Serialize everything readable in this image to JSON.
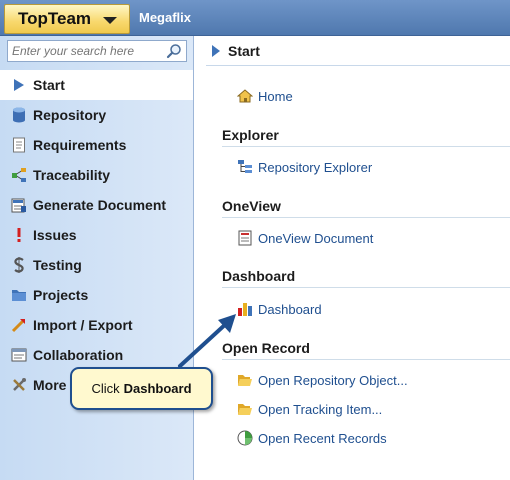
{
  "topbar": {
    "app_name": "TopTeam",
    "project_name": "Megaflix"
  },
  "search": {
    "placeholder": "Enter your search here"
  },
  "sidebar": {
    "items": [
      {
        "label": "Start",
        "icon": "start-icon"
      },
      {
        "label": "Repository",
        "icon": "repository-icon"
      },
      {
        "label": "Requirements",
        "icon": "requirements-icon"
      },
      {
        "label": "Traceability",
        "icon": "traceability-icon"
      },
      {
        "label": "Generate Document",
        "icon": "generate-document-icon"
      },
      {
        "label": "Issues",
        "icon": "issues-icon"
      },
      {
        "label": "Testing",
        "icon": "testing-icon"
      },
      {
        "label": "Projects",
        "icon": "projects-icon"
      },
      {
        "label": "Import / Export",
        "icon": "import-export-icon"
      },
      {
        "label": "Collaboration",
        "icon": "collaboration-icon"
      },
      {
        "label": "More",
        "icon": "more-icon"
      }
    ]
  },
  "main": {
    "title": "Start",
    "home": "Home",
    "sections": {
      "explorer": {
        "title": "Explorer",
        "link": "Repository Explorer"
      },
      "oneview": {
        "title": "OneView",
        "link": "OneView Document"
      },
      "dashboard": {
        "title": "Dashboard",
        "link": "Dashboard"
      },
      "open_record": {
        "title": "Open Record",
        "links": [
          "Open Repository Object...",
          "Open Tracking Item...",
          "Open Recent Records"
        ]
      }
    }
  },
  "callout": {
    "prefix": "Click",
    "target": "Dashboard"
  },
  "colors": {
    "accent": "#3f73b8",
    "link": "#1f4f8f",
    "callout_bg": "#fff9cf",
    "app_button": "#f8d86d"
  }
}
